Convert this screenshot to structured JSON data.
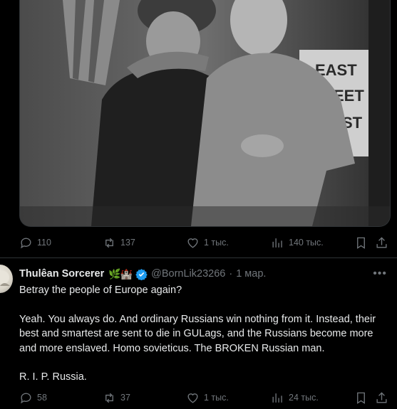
{
  "tweet1": {
    "photo": {
      "sign_lines": [
        "EAST",
        "EET",
        "ST"
      ]
    },
    "actions": {
      "replies": "110",
      "retweets": "137",
      "likes": "1 тыс.",
      "views": "140 тыс."
    }
  },
  "tweet2": {
    "author_name": "Thulêan Sorcerer",
    "name_emoji": "🌿🏰",
    "handle": "@BornLik23266",
    "separator": "·",
    "date": "1 мар.",
    "paragraphs": [
      "Betray the people of Europe again?",
      "Yeah. You always do. And ordinary Russians win nothing from it. Instead, their best and smartest are sent to die in GULags, and the Russians become more and more enslaved. Homo sovieticus. The BROKEN Russian man.",
      "R. I. P. Russia."
    ],
    "actions": {
      "replies": "58",
      "retweets": "37",
      "likes": "1 тыс.",
      "views": "24 тыс."
    }
  },
  "colors": {
    "background": "#000000",
    "text": "#e7e9ea",
    "muted": "#71767b",
    "verified": "#1d9bf0",
    "border": "#2f3336"
  }
}
